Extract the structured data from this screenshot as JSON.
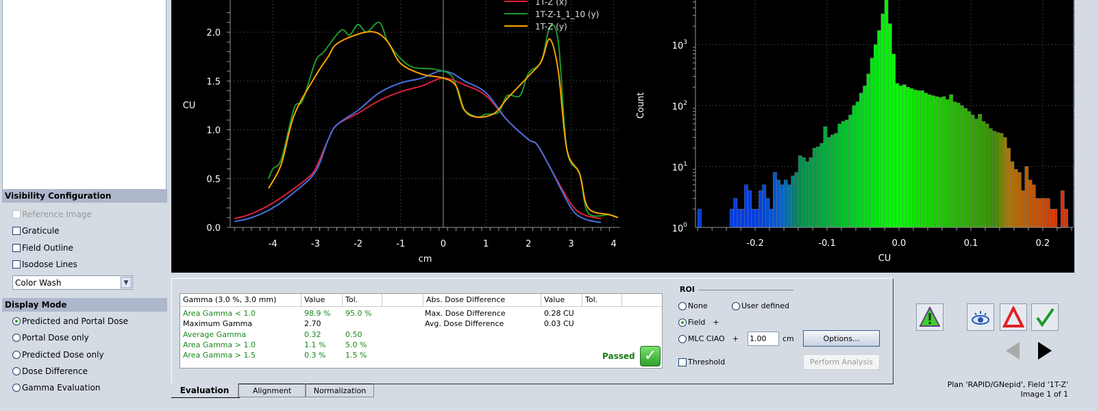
{
  "visibility": {
    "title": "Visibility Configuration",
    "items": [
      {
        "label": "Reference Image",
        "checked": false,
        "disabled": true
      },
      {
        "label": "Graticule",
        "checked": false
      },
      {
        "label": "Field Outline",
        "checked": false
      },
      {
        "label": "Isodose Lines",
        "checked": false
      }
    ],
    "colormap": "Color Wash"
  },
  "display_mode": {
    "title": "Display Mode",
    "options": [
      {
        "label": "Predicted and Portal Dose",
        "selected": true
      },
      {
        "label": "Portal Dose only"
      },
      {
        "label": "Predicted Dose only"
      },
      {
        "label": "Dose Difference"
      },
      {
        "label": "Gamma Evaluation"
      }
    ]
  },
  "chart_data": [
    {
      "type": "line",
      "xlabel": "cm",
      "ylabel": "CU",
      "xlim": [
        -5,
        4.15
      ],
      "ylim": [
        0,
        2.33
      ],
      "xticks": [
        -4,
        -3,
        -2,
        -1,
        0,
        1,
        2,
        3,
        4
      ],
      "yticks": [
        0.0,
        0.5,
        1.0,
        1.5,
        2.0
      ],
      "ytick_labels": [
        "0.0",
        "0.5",
        "1.0",
        "1.5",
        "2.0"
      ],
      "grid": true,
      "legend": "top-right",
      "series": [
        {
          "name": "1T-Z (x)",
          "color": "#e0203c",
          "x": [
            -4.9,
            -4.5,
            -4,
            -3.5,
            -3.2,
            -3,
            -2.7,
            -2.5,
            -2,
            -1.5,
            -1,
            -0.5,
            0,
            0.5,
            1,
            1.5,
            2,
            2.2,
            2.5,
            3,
            3.3,
            3.7
          ],
          "y": [
            0.09,
            0.14,
            0.25,
            0.4,
            0.5,
            0.6,
            0.9,
            1.05,
            1.17,
            1.3,
            1.39,
            1.45,
            1.53,
            1.46,
            1.35,
            1.1,
            0.9,
            0.85,
            0.62,
            0.24,
            0.13,
            0.09
          ]
        },
        {
          "color": "#4a6fe0",
          "x": [
            -4.9,
            -4.5,
            -4,
            -3.5,
            -3,
            -2.7,
            -2.5,
            -2,
            -1.5,
            -1,
            -0.5,
            -0.1,
            0.2,
            0.5,
            1,
            1.5,
            2,
            2.2,
            2.5,
            3,
            3.3,
            3.7
          ],
          "y": [
            0.06,
            0.1,
            0.2,
            0.36,
            0.57,
            0.9,
            1.05,
            1.2,
            1.38,
            1.48,
            1.53,
            1.6,
            1.58,
            1.5,
            1.38,
            1.1,
            0.9,
            0.85,
            0.62,
            0.2,
            0.09,
            0.05
          ]
        },
        {
          "name": "1T-Z-1_1_10 (y)",
          "color": "#1e9a2a",
          "x": [
            -4.1,
            -4,
            -3.8,
            -3.5,
            -3.3,
            -3,
            -2.8,
            -2.4,
            -2.2,
            -2,
            -1.8,
            -1.5,
            -1.3,
            -1,
            -0.7,
            -0.2,
            0.2,
            0.4,
            0.5,
            0.8,
            1,
            1.3,
            1.5,
            1.8,
            2,
            2.3,
            2.5,
            2.7,
            2.9,
            3.2,
            3.4,
            3.9,
            4.1
          ],
          "y": [
            0.5,
            0.6,
            0.7,
            1.22,
            1.3,
            1.7,
            1.8,
            2.02,
            1.97,
            2.08,
            2.0,
            2.1,
            1.9,
            1.73,
            1.64,
            1.62,
            1.55,
            1.3,
            1.2,
            1.13,
            1.16,
            1.18,
            1.35,
            1.35,
            1.58,
            1.7,
            2.05,
            1.9,
            0.8,
            0.55,
            0.15,
            0.13,
            0.1
          ]
        },
        {
          "name": "1T-Z (y)",
          "color": "#ffa500",
          "x": [
            -4.1,
            -3.8,
            -3.5,
            -3,
            -2.7,
            -2.5,
            -2,
            -1.6,
            -1.3,
            -1,
            -0.5,
            0,
            0.3,
            0.5,
            0.8,
            1.2,
            1.5,
            2,
            2.3,
            2.5,
            2.7,
            2.9,
            3.2,
            3.4,
            3.9,
            4.1
          ],
          "y": [
            0.4,
            0.65,
            1.15,
            1.55,
            1.75,
            1.88,
            1.98,
            2.0,
            1.9,
            1.68,
            1.57,
            1.53,
            1.45,
            1.2,
            1.13,
            1.17,
            1.32,
            1.55,
            1.7,
            1.93,
            1.6,
            0.8,
            0.55,
            0.2,
            0.13,
            0.1
          ]
        }
      ]
    },
    {
      "type": "bar",
      "subtype": "histogram",
      "xlabel": "CU",
      "ylabel": "Count",
      "yscale": "log",
      "xlim": [
        -0.283,
        0.243
      ],
      "ylim": [
        1,
        5400
      ],
      "xticks": [
        -0.2,
        -0.1,
        0.0,
        0.1,
        0.2
      ],
      "xtick_labels": [
        "-0.2",
        "-0.1",
        "0.0",
        "0.1",
        "0.2"
      ],
      "yticks": [
        1,
        10,
        100,
        1000
      ],
      "ytick_labels": [
        "0",
        "1",
        "2",
        "3"
      ],
      "grid": true,
      "bin_width": 0.005,
      "bin_start": [
        -0.28,
        -0.235,
        -0.23,
        -0.225,
        -0.22,
        -0.215,
        -0.21,
        -0.205,
        -0.2,
        -0.195,
        -0.19,
        -0.185,
        -0.18,
        -0.175,
        -0.17,
        -0.165,
        -0.16,
        -0.155,
        -0.15,
        -0.145,
        -0.14,
        -0.135,
        -0.13,
        -0.125,
        -0.12,
        -0.115,
        -0.11,
        -0.105,
        -0.1,
        -0.095,
        -0.09,
        -0.085,
        -0.08,
        -0.075,
        -0.07,
        -0.065,
        -0.06,
        -0.055,
        -0.05,
        -0.045,
        -0.04,
        -0.035,
        -0.03,
        -0.025,
        -0.02,
        -0.015,
        -0.01,
        -0.005,
        0,
        0.005,
        0.01,
        0.015,
        0.02,
        0.025,
        0.03,
        0.035,
        0.04,
        0.045,
        0.05,
        0.055,
        0.06,
        0.065,
        0.07,
        0.075,
        0.08,
        0.085,
        0.09,
        0.095,
        0.1,
        0.105,
        0.11,
        0.115,
        0.12,
        0.125,
        0.13,
        0.135,
        0.14,
        0.145,
        0.15,
        0.155,
        0.16,
        0.165,
        0.17,
        0.175,
        0.18,
        0.185,
        0.19,
        0.195,
        0.2,
        0.205,
        0.21,
        0.215,
        0.22,
        0.225,
        0.23
      ],
      "counts": [
        2,
        2,
        3,
        2,
        2,
        5,
        4,
        2,
        2,
        4,
        5,
        3,
        2,
        8,
        6,
        5,
        6,
        5,
        7,
        8,
        15,
        14,
        12,
        14,
        20,
        21,
        24,
        45,
        30,
        33,
        35,
        50,
        55,
        58,
        70,
        100,
        115,
        160,
        210,
        330,
        600,
        1000,
        1700,
        3200,
        5500,
        2200,
        700,
        230,
        210,
        220,
        200,
        190,
        180,
        175,
        175,
        160,
        150,
        145,
        140,
        135,
        140,
        125,
        150,
        115,
        110,
        100,
        90,
        80,
        70,
        60,
        72,
        55,
        50,
        42,
        38,
        36,
        35,
        30,
        20,
        12,
        9,
        8,
        4,
        10,
        6,
        5,
        3,
        3,
        3,
        3,
        2,
        2,
        1,
        4,
        2
      ]
    }
  ],
  "evaluation": {
    "headers": [
      "Gamma (3.0 %, 3.0 mm)",
      "Value",
      "Tol."
    ],
    "rows": [
      {
        "label": "Area Gamma < 1.0",
        "value": "98.9 %",
        "tol": "95.0 %",
        "pass": true
      },
      {
        "label": "Maximum Gamma",
        "value": "2.70",
        "tol": "",
        "pass": null
      },
      {
        "label": "Average Gamma",
        "value": "0.32",
        "tol": "0.50",
        "pass": true
      },
      {
        "label": "Area Gamma > 1.0",
        "value": "1.1 %",
        "tol": "5.0 %",
        "pass": true
      },
      {
        "label": "Area Gamma > 1.5",
        "value": "0.3 %",
        "tol": "1.5 %",
        "pass": true
      }
    ],
    "dose_headers": [
      "Abs. Dose Difference",
      "Value",
      "Tol."
    ],
    "dose_rows": [
      {
        "label": "Max. Dose Difference",
        "value": "0.28 CU"
      },
      {
        "label": "Avg. Dose Difference",
        "value": "0.03 CU"
      }
    ],
    "status": "Passed"
  },
  "roi": {
    "title": "ROI",
    "none": "None",
    "user": "User defined",
    "field": "Field",
    "plus": "+",
    "mlc": "MLC CIAO",
    "margin": "1.00",
    "unit": "cm",
    "threshold": "Threshold",
    "options_btn": "Options...",
    "perform_btn": "Perform Analysis",
    "selected": "Field"
  },
  "tabs": [
    "Evaluation",
    "Alignment",
    "Normalization"
  ],
  "active_tab": "Evaluation",
  "status": {
    "plan": "Plan 'RAPID/GNepid', Field '1T-Z'",
    "image": "Image 1 of 1"
  }
}
